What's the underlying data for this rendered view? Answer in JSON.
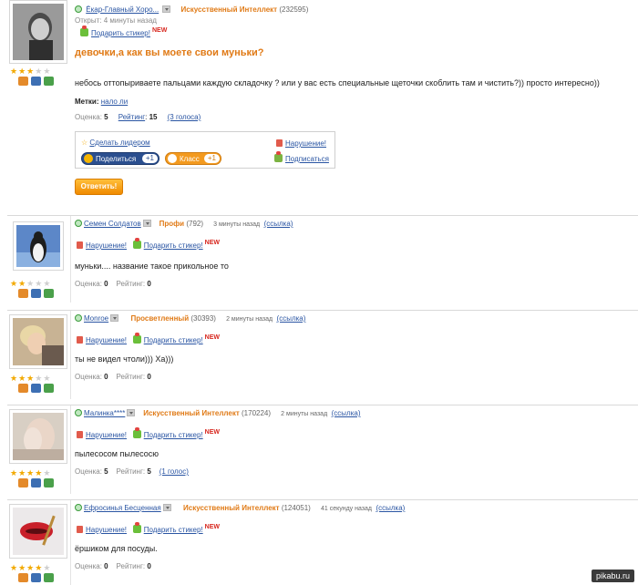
{
  "question": {
    "author": "Ёкар-Главный Хоро...",
    "rank": "Искусственный Интеллект",
    "points": "(232595)",
    "opened": "Открыт: 4 минуты назад",
    "gift_sticker": "Подарить стикер!",
    "new": "NEW",
    "title": "девочки,а как вы моете свои муньки?",
    "body": "небось оттопыриваете пальцами каждую складочку ? или у вас есть специальные щеточки скоблить там и чистить?)) просто интересно))",
    "tags_label": "Метки:",
    "tags_value": "нало ли",
    "rating_label": "Оценка:",
    "rating_value": "5",
    "rank_link": "Рейтинг",
    "rank_value": "15",
    "votes": "(3 голоса)",
    "stars_on": 3,
    "stars_total": 5,
    "make_leader": "Сделать лидером",
    "violation": "Нарушение!",
    "share": "Поделиться",
    "share_count": "+1",
    "klass": "Класс",
    "klass_count": "+1",
    "subscribe": "Подписаться",
    "answer_button": "Ответить!"
  },
  "answers": [
    {
      "user": "Семен Солдатов",
      "rank": "Профи",
      "points": "(792)",
      "time": "3 минуты назад",
      "link": "(ссылка)",
      "violation": "Нарушение!",
      "gift": "Подарить стикер!",
      "new": "NEW",
      "text": "муньки.... название такое прикольное то",
      "rating_label": "Оценка:",
      "rating_value": "0",
      "rank_label": "Рейтинг:",
      "rank_value": "0",
      "votes": "",
      "stars_on": 2
    },
    {
      "user": "Monroe",
      "rank": "Просветленный",
      "points": "(30393)",
      "time": "2 минуты назад",
      "link": "(ссылка)",
      "violation": "Нарушение!",
      "gift": "Подарить стикер!",
      "new": "NEW",
      "text": "ты не видел чтоли))) Ха)))",
      "rating_label": "Оценка:",
      "rating_value": "0",
      "rank_label": "Рейтинг:",
      "rank_value": "0",
      "votes": "",
      "stars_on": 3
    },
    {
      "user": "Малинка****",
      "rank": "Искусственный Интеллект",
      "points": "(170224)",
      "time": "2 минуты назад",
      "link": "(ссылка)",
      "violation": "Нарушение!",
      "gift": "Подарить стикер!",
      "new": "NEW",
      "text": "пылесосом пылесосю",
      "rating_label": "Оценка:",
      "rating_value": "5",
      "rank_label": "Рейтинг:",
      "rank_value": "5",
      "votes": "(1 голос)",
      "stars_on": 4
    },
    {
      "user": "Ефросинья Бесценная",
      "rank": "Искусственный Интеллект",
      "points": "(124051)",
      "time": "41 секунду назад",
      "link": "(ссылка)",
      "violation": "Нарушение!",
      "gift": "Подарить стикер!",
      "new": "NEW",
      "text": "ёршиком для посуды.",
      "rating_label": "Оценка:",
      "rating_value": "0",
      "rank_label": "Рейтинг:",
      "rank_value": "0",
      "votes": "",
      "stars_on": 4
    }
  ],
  "watermark": "pikabu.ru",
  "colors": {
    "accent_orange": "#e07a16",
    "link_blue": "#2a55a3",
    "star": "#f2a900",
    "new_red": "#d7261d"
  }
}
